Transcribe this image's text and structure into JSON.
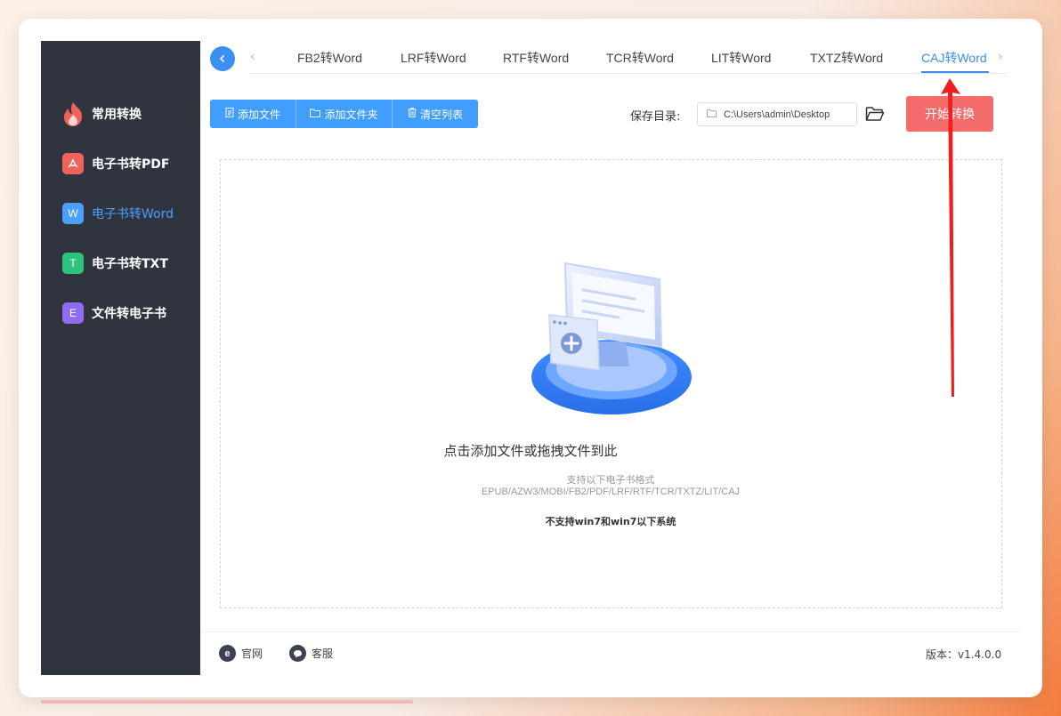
{
  "sidebar": {
    "items": [
      {
        "label": "常用转换",
        "icon": "fire-icon",
        "color": "#f0625a"
      },
      {
        "label": "电子书转PDF",
        "icon": "pdf-icon",
        "color": "#f0625a"
      },
      {
        "label": "电子书转Word",
        "icon": "word-icon",
        "color": "#4a9fff",
        "glyph": "W"
      },
      {
        "label": "电子书转TXT",
        "icon": "txt-icon",
        "color": "#2ec27e",
        "glyph": "T"
      },
      {
        "label": "文件转电子书",
        "icon": "ebook-icon",
        "color": "#8f6cf0",
        "glyph": "E"
      }
    ],
    "active_index": 2
  },
  "tabs": {
    "items": [
      "FB2转Word",
      "LRF转Word",
      "RTF转Word",
      "TCR转Word",
      "LIT转Word",
      "TXTZ转Word",
      "CAJ转Word"
    ],
    "active_index": 6
  },
  "toolbar": {
    "add_file": "添加文件",
    "add_folder": "添加文件夹",
    "clear_list": "清空列表",
    "save_dir_label": "保存目录:",
    "save_path": "C:\\Users\\admin\\Desktop",
    "start": "开始转换"
  },
  "dropzone": {
    "title": "点击添加文件或拖拽文件到此",
    "support_label": "支持以下电子书格式",
    "formats": "EPUB/AZW3/MOBI/FB2/PDF/LRF/RTF/TCR/TXTZ/LIT/CAJ",
    "warning": "不支持win7和win7以下系统"
  },
  "footer": {
    "website": "官网",
    "support": "客服",
    "version": "版本：v1.4.0.0"
  },
  "colors": {
    "accent": "#409eff",
    "danger": "#f56c6c",
    "sidebar_bg": "#30343f"
  }
}
